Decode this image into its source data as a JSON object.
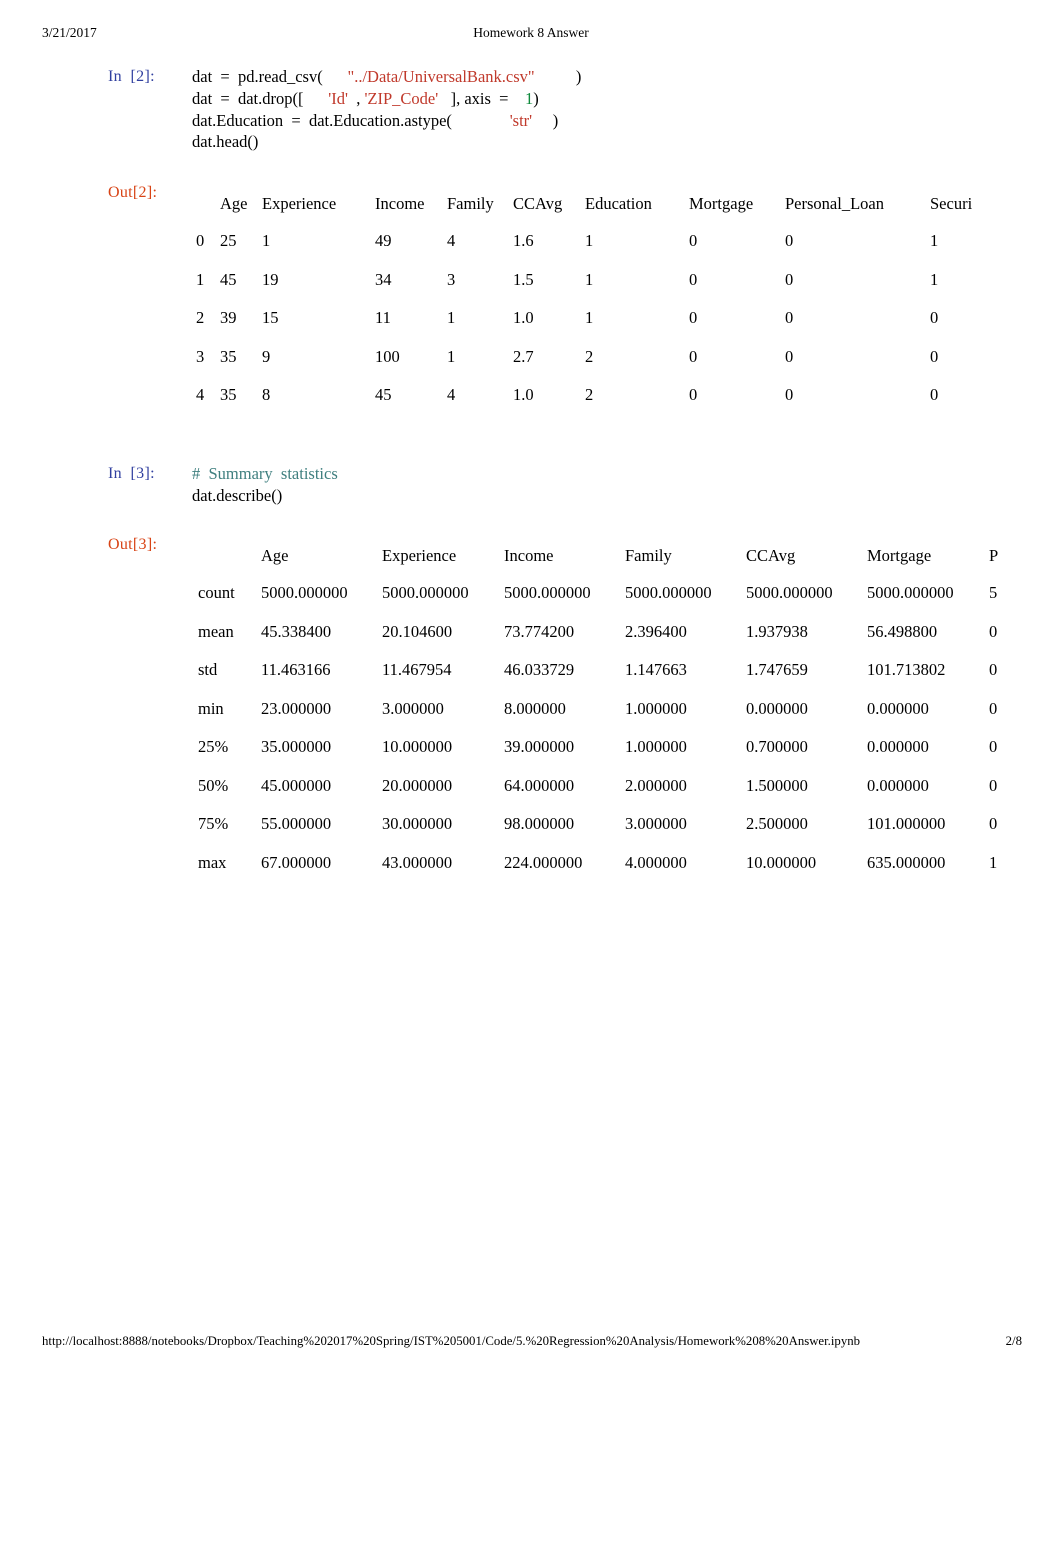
{
  "page": {
    "header_date": "3/21/2017",
    "header_title": "Homework 8 Answer",
    "footer_url": "http://localhost:8888/notebooks/Dropbox/Teaching%202017%20Spring/IST%205001/Code/5.%20Regression%20Analysis/Homework%208%20Answer.ipynb",
    "footer_page": "2/8"
  },
  "colors": {
    "prompt_in": "#303f9f",
    "prompt_out": "#d84315",
    "string_token": "#c0392b",
    "number_token": "#0f8a3c",
    "comment_token": "#3f7f7f",
    "text": "#000000",
    "background": "#ffffff"
  },
  "cells": [
    {
      "prompt": "In  [2]:",
      "code_lines": [
        [
          {
            "t": "dat  =  pd.read_csv(      ",
            "k": "plain"
          },
          {
            "t": "\"../Data/UniversalBank.csv\"",
            "k": "str"
          },
          {
            "t": "          )",
            "k": "plain"
          }
        ],
        [
          {
            "t": "dat  =  dat.drop([      ",
            "k": "plain"
          },
          {
            "t": "'Id'",
            "k": "str"
          },
          {
            "t": "  , ",
            "k": "plain"
          },
          {
            "t": "'ZIP_Code'",
            "k": "str"
          },
          {
            "t": "   ], axis  =    ",
            "k": "plain"
          },
          {
            "t": "1",
            "k": "num"
          },
          {
            "t": ")",
            "k": "plain"
          }
        ],
        [
          {
            "t": "dat.Education  =  dat.Education.astype(              ",
            "k": "plain"
          },
          {
            "t": "'str'",
            "k": "str"
          },
          {
            "t": "     )",
            "k": "plain"
          }
        ],
        [
          {
            "t": "dat.head()",
            "k": "plain"
          }
        ]
      ]
    },
    {
      "prompt": "In  [3]:",
      "code_lines": [
        [
          {
            "t": "#  Summary  statistics",
            "k": "cmt"
          }
        ],
        [
          {
            "t": "dat.describe()",
            "k": "plain"
          }
        ]
      ]
    }
  ],
  "out_head": {
    "prompt": "Out[2]:",
    "index_header": "",
    "columns": [
      "Age",
      "Experience",
      "Income",
      "Family",
      "CCAvg",
      "Education",
      "Mortgage",
      "Personal_Loan",
      "Securi"
    ],
    "index": [
      "0",
      "1",
      "2",
      "3",
      "4"
    ],
    "rows": [
      [
        "25",
        "1",
        "49",
        "4",
        "1.6",
        "1",
        "0",
        "0",
        "1"
      ],
      [
        "45",
        "19",
        "34",
        "3",
        "1.5",
        "1",
        "0",
        "0",
        "1"
      ],
      [
        "39",
        "15",
        "11",
        "1",
        "1.0",
        "1",
        "0",
        "0",
        "0"
      ],
      [
        "35",
        "9",
        "100",
        "1",
        "2.7",
        "2",
        "0",
        "0",
        "0"
      ],
      [
        "35",
        "8",
        "45",
        "4",
        "1.0",
        "2",
        "0",
        "0",
        "0"
      ]
    ]
  },
  "out_describe": {
    "prompt": "Out[3]:",
    "index_header": "",
    "columns": [
      "Age",
      "Experience",
      "Income",
      "Family",
      "CCAvg",
      "Mortgage",
      "P"
    ],
    "index": [
      "count",
      "mean",
      "std",
      "min",
      "25%",
      "50%",
      "75%",
      "max"
    ],
    "rows": [
      [
        "5000.000000",
        "5000.000000",
        "5000.000000",
        "5000.000000",
        "5000.000000",
        "5000.000000",
        "5"
      ],
      [
        "45.338400",
        "20.104600",
        "73.774200",
        "2.396400",
        "1.937938",
        "56.498800",
        "0"
      ],
      [
        "11.463166",
        "11.467954",
        "46.033729",
        "1.147663",
        "1.747659",
        "101.713802",
        "0"
      ],
      [
        "23.000000",
        "3.000000",
        "8.000000",
        "1.000000",
        "0.000000",
        "0.000000",
        "0"
      ],
      [
        "35.000000",
        "10.000000",
        "39.000000",
        "1.000000",
        "0.700000",
        "0.000000",
        "0"
      ],
      [
        "45.000000",
        "20.000000",
        "64.000000",
        "2.000000",
        "1.500000",
        "0.000000",
        "0"
      ],
      [
        "55.000000",
        "30.000000",
        "98.000000",
        "3.000000",
        "2.500000",
        "101.000000",
        "0"
      ],
      [
        "67.000000",
        "43.000000",
        "224.000000",
        "4.000000",
        "10.000000",
        "635.000000",
        "1"
      ]
    ]
  }
}
